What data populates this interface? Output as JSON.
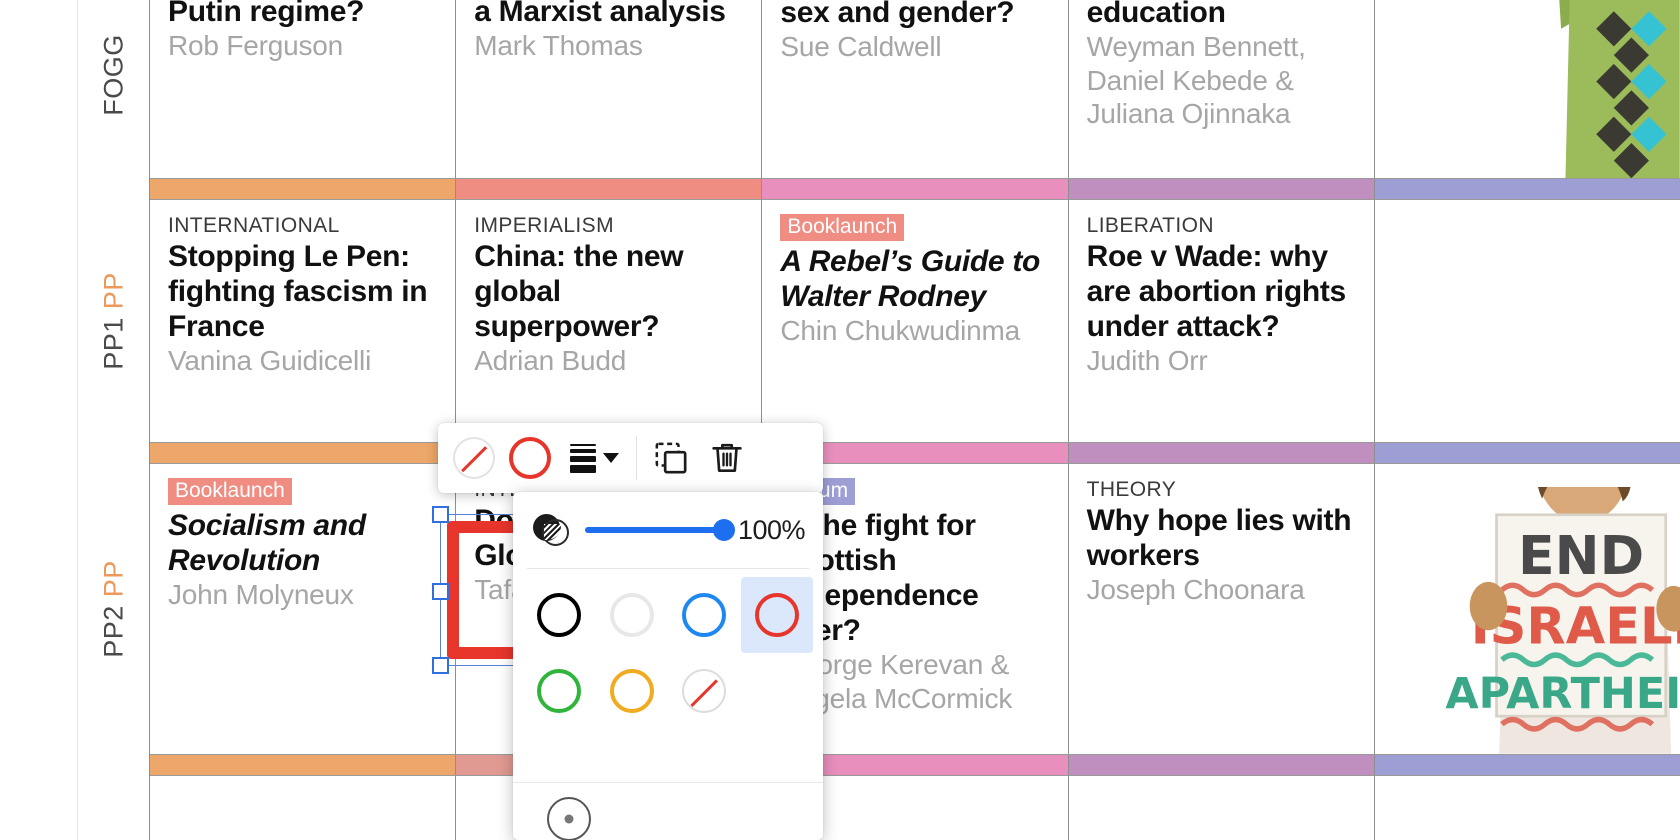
{
  "grid": {
    "rows": [
      {
        "id": "row-fogg",
        "label_plain": "FOGG",
        "label_accent": "",
        "cells": [
          {
            "kicker": "",
            "tag": "",
            "headline": "Putin regime?",
            "byline": "Rob Ferguson",
            "photo": null
          },
          {
            "kicker": "",
            "tag": "",
            "headline": "a Marxist analysis",
            "byline": "Mark Thomas",
            "photo": null
          },
          {
            "kicker": "",
            "tag": "",
            "headline": "difference between sex and gender?",
            "byline": "Sue Caldwell",
            "photo": null
          },
          {
            "kicker": "",
            "tag": "",
            "headline": "resisting racism in education",
            "byline": "Weyman Bennett, Daniel Kebede & Juliana Ojinnaka",
            "photo": null
          },
          {
            "kicker": "",
            "tag": "",
            "headline": "",
            "byline": "",
            "photo": "protester-arm-raised"
          }
        ]
      },
      {
        "id": "row-pp1",
        "label_plain": "PP1",
        "label_accent": "PP",
        "cells": [
          {
            "kicker": "INTERNATIONAL",
            "tag": "",
            "headline": "Stopping Le Pen: fighting fascism in France",
            "byline": "Vanina Guidicelli",
            "photo": null
          },
          {
            "kicker": "IMPERIALISM",
            "tag": "",
            "headline": "China: the new global superpower?",
            "byline": "Adrian Budd",
            "photo": null
          },
          {
            "kicker": "",
            "tag": "Booklaunch",
            "headline": "A Rebel’s Guide to Walter Rodney",
            "byline": "Chin Chukwudinma",
            "photo": null,
            "italic": true
          },
          {
            "kicker": "LIBERATION",
            "tag": "",
            "headline": "Roe v Wade: why are abortion rights under attack?",
            "byline": "Judith Orr",
            "photo": null
          },
          {
            "kicker": "",
            "tag": "",
            "headline": "",
            "byline": "",
            "photo": null
          }
        ]
      },
      {
        "id": "row-pp2",
        "label_plain": "PP2",
        "label_accent": "PP",
        "cells": [
          {
            "kicker": "",
            "tag": "Booklaunch",
            "headline": "Socialism and Revolution",
            "byline": "John Molyneux",
            "photo": null,
            "italic": true
          },
          {
            "kicker": "INTERNATIONAL",
            "tag": "",
            "headline": "Do we benefit from Global explo",
            "byline": "Tafadzwa",
            "photo": null
          },
          {
            "kicker": "",
            "tag": "Forum",
            "headline": "Is the fight for Scottish independence over?",
            "byline": "George Kerevan & Angela McCormick",
            "photo": null
          },
          {
            "kicker": "THEORY",
            "tag": "",
            "headline": "Why hope lies with workers",
            "byline": "Joseph Choonara",
            "photo": null
          },
          {
            "kicker": "",
            "tag": "",
            "headline": "",
            "byline": "",
            "photo": "end-israeli-apartheid-placard"
          }
        ]
      }
    ],
    "band_colors": [
      "#eda76a",
      "#ef8d82",
      "#e98fbe",
      "#bf90bf",
      "#9d9ed4"
    ],
    "tag_colors": {
      "Booklaunch": "#ef8d82",
      "Forum": "#9d9ed4"
    }
  },
  "toolbar": {
    "items": [
      {
        "name": "fill-no-color-button",
        "label": "No fill"
      },
      {
        "name": "stroke-color-button",
        "label": "Stroke colour"
      },
      {
        "name": "line-weight-button",
        "label": "Line weight"
      },
      {
        "name": "duplicate-button",
        "label": "Duplicate"
      },
      {
        "name": "delete-button",
        "label": "Delete"
      }
    ],
    "stroke_color": "#e8352b"
  },
  "color_panel": {
    "opacity_label": "100%",
    "opacity_value": 100,
    "slider_fill_color": "#1e6ef0",
    "swatches": [
      {
        "name": "swatch-black",
        "color": "#000000",
        "selected": false,
        "none": false
      },
      {
        "name": "swatch-light-grey",
        "color": "#e8e8e8",
        "selected": false,
        "none": false
      },
      {
        "name": "swatch-blue",
        "color": "#1e88f0",
        "selected": false,
        "none": false
      },
      {
        "name": "swatch-red",
        "color": "#e8352b",
        "selected": true,
        "none": false
      },
      {
        "name": "swatch-green",
        "color": "#31b43c",
        "selected": false,
        "none": false
      },
      {
        "name": "swatch-orange",
        "color": "#f0ab20",
        "selected": false,
        "none": false
      },
      {
        "name": "swatch-no-color",
        "color": "",
        "selected": false,
        "none": true
      }
    ],
    "custom_color_label": "Custom colour"
  },
  "selection": {
    "shape_color": "#e8352b",
    "handle_border": "#2f6fe0"
  }
}
